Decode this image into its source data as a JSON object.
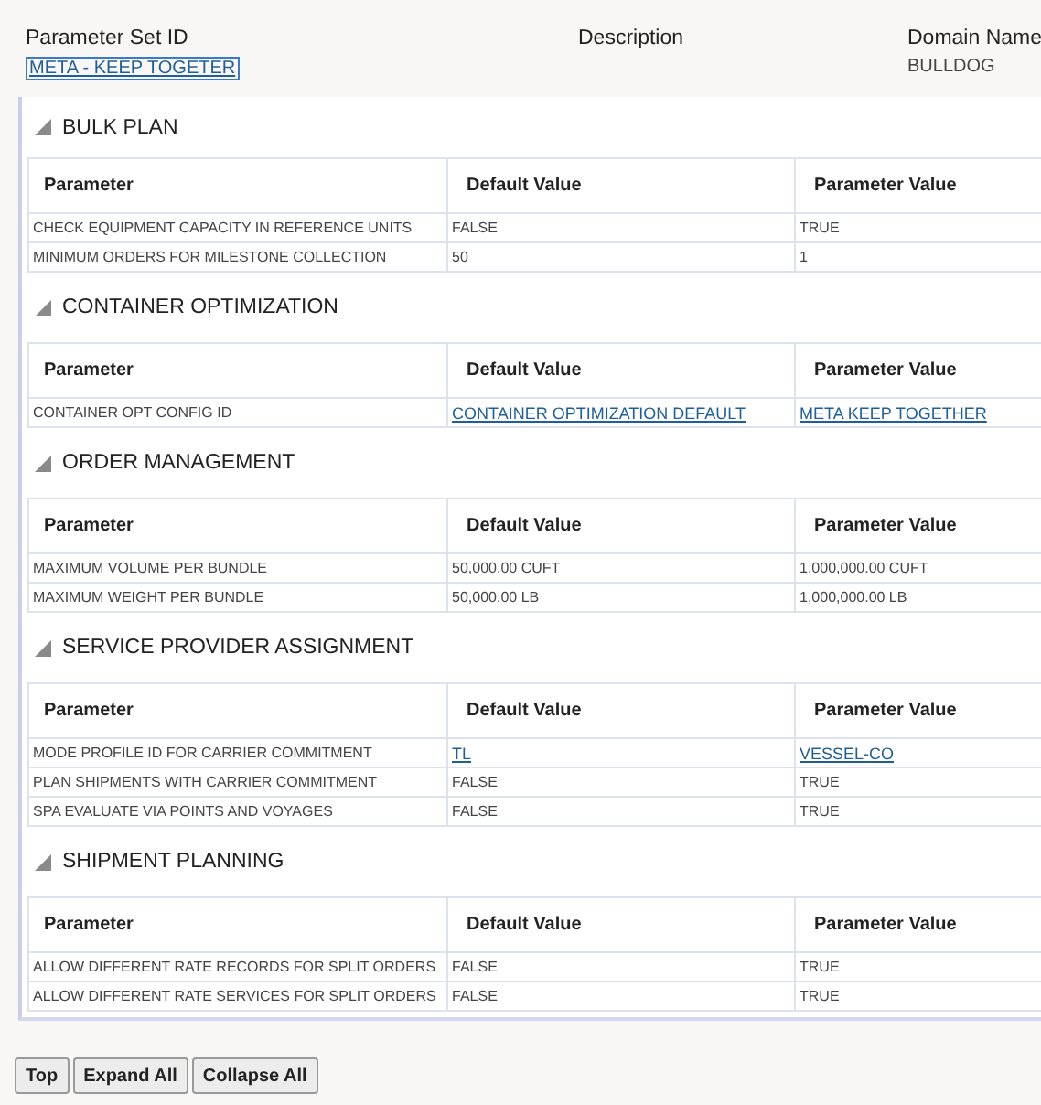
{
  "header": {
    "fields": [
      {
        "label": "Parameter Set ID",
        "value": "META - KEEP TOGETER",
        "kind": "link"
      },
      {
        "label": "Description"
      },
      {
        "label": "Domain Name",
        "value": "BULLDOG",
        "kind": "text"
      }
    ]
  },
  "sections": [
    {
      "title": "BULK PLAN",
      "expanded": true,
      "columns": [
        "Parameter",
        "Default Value",
        "Parameter Value"
      ],
      "rows": [
        {
          "parameter": "CHECK EQUIPMENT CAPACITY IN REFERENCE UNITS",
          "default": {
            "text": "FALSE",
            "link": false
          },
          "value": {
            "text": "TRUE",
            "link": false
          }
        },
        {
          "parameter": "MINIMUM ORDERS FOR MILESTONE COLLECTION",
          "default": {
            "text": "50",
            "link": false
          },
          "value": {
            "text": "1",
            "link": false
          }
        }
      ]
    },
    {
      "title": "CONTAINER OPTIMIZATION",
      "expanded": true,
      "columns": [
        "Parameter",
        "Default Value",
        "Parameter Value"
      ],
      "rows": [
        {
          "parameter": "CONTAINER OPT CONFIG ID",
          "default": {
            "text": "CONTAINER OPTIMIZATION DEFAULT",
            "link": true
          },
          "value": {
            "text": "META KEEP TOGETHER",
            "link": true
          }
        }
      ]
    },
    {
      "title": "ORDER MANAGEMENT",
      "expanded": true,
      "columns": [
        "Parameter",
        "Default Value",
        "Parameter Value"
      ],
      "rows": [
        {
          "parameter": "MAXIMUM VOLUME PER BUNDLE",
          "default": {
            "text": "50,000.00 CUFT",
            "link": false
          },
          "value": {
            "text": "1,000,000.00 CUFT",
            "link": false
          }
        },
        {
          "parameter": "MAXIMUM WEIGHT PER BUNDLE",
          "default": {
            "text": "50,000.00 LB",
            "link": false
          },
          "value": {
            "text": "1,000,000.00 LB",
            "link": false
          }
        }
      ]
    },
    {
      "title": "SERVICE PROVIDER ASSIGNMENT",
      "expanded": true,
      "columns": [
        "Parameter",
        "Default Value",
        "Parameter Value"
      ],
      "rows": [
        {
          "parameter": "MODE PROFILE ID FOR CARRIER COMMITMENT",
          "default": {
            "text": "TL",
            "link": true
          },
          "value": {
            "text": "VESSEL-CO",
            "link": true
          }
        },
        {
          "parameter": "PLAN SHIPMENTS WITH CARRIER COMMITMENT",
          "default": {
            "text": "FALSE",
            "link": false
          },
          "value": {
            "text": "TRUE",
            "link": false
          }
        },
        {
          "parameter": "SPA EVALUATE VIA POINTS AND VOYAGES",
          "default": {
            "text": "FALSE",
            "link": false
          },
          "value": {
            "text": "TRUE",
            "link": false
          }
        }
      ]
    },
    {
      "title": "SHIPMENT PLANNING",
      "expanded": true,
      "columns": [
        "Parameter",
        "Default Value",
        "Parameter Value"
      ],
      "rows": [
        {
          "parameter": "ALLOW DIFFERENT RATE RECORDS FOR SPLIT ORDERS",
          "default": {
            "text": "FALSE",
            "link": false
          },
          "value": {
            "text": "TRUE",
            "link": false
          }
        },
        {
          "parameter": "ALLOW DIFFERENT RATE SERVICES FOR SPLIT ORDERS",
          "default": {
            "text": "FALSE",
            "link": false
          },
          "value": {
            "text": "TRUE",
            "link": false
          }
        }
      ]
    }
  ],
  "buttons": [
    "Top",
    "Expand All",
    "Collapse All"
  ]
}
